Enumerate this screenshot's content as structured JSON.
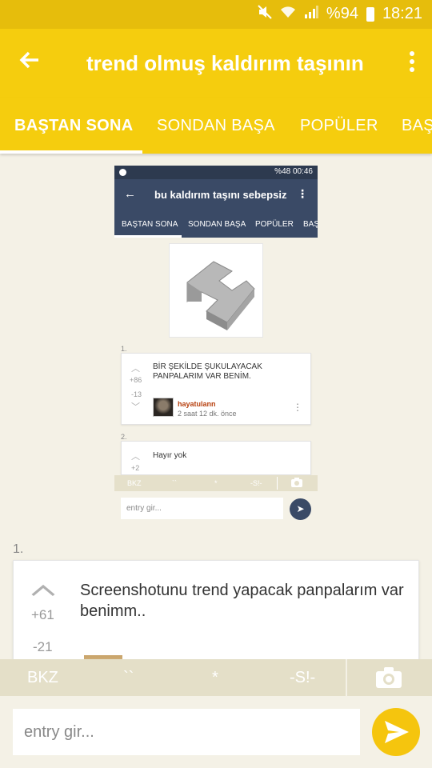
{
  "status_bar": {
    "battery": "%94",
    "time": "18:21"
  },
  "app_bar": {
    "title": "trend olmuş kaldırım taşının"
  },
  "tabs": [
    {
      "label": "BAŞTAN SONA",
      "active": true
    },
    {
      "label": "SONDAN BAŞA",
      "active": false
    },
    {
      "label": "POPÜLER",
      "active": false
    },
    {
      "label": "BAŞ",
      "active": false
    }
  ],
  "embedded": {
    "status_text": "%48 00:46",
    "title": "bu kaldırım taşını sebepsiz",
    "tabs": [
      "BAŞTAN SONA",
      "SONDAN BAŞA",
      "POPÜLER",
      "BAŞ"
    ],
    "entries": [
      {
        "num": "1.",
        "text": "BİR ŞEKİLDE ŞUKULAYACAK PANPALARIM VAR BENİM.",
        "up": "+86",
        "down": "-13",
        "user": "hayatulann",
        "time": "2 saat 12 dk. önce"
      },
      {
        "num": "2.",
        "text": "Hayır yok",
        "up": "+2"
      }
    ],
    "toolbar": [
      "BKZ",
      "``",
      "*",
      "-S!-"
    ],
    "input_placeholder": "entry gir..."
  },
  "entry": {
    "num": "1.",
    "text": "Screenshotunu trend yapacak panpalarım var benimm..",
    "up": "+61",
    "down": "-21"
  },
  "toolbar": {
    "bkz": "BKZ",
    "backticks": "``",
    "star": "*",
    "spoiler": "-S!-"
  },
  "input": {
    "placeholder": "entry gir..."
  },
  "colors": {
    "accent": "#f5cd0e",
    "embedded_accent": "#3a4a66",
    "background": "#f4f1e6"
  }
}
